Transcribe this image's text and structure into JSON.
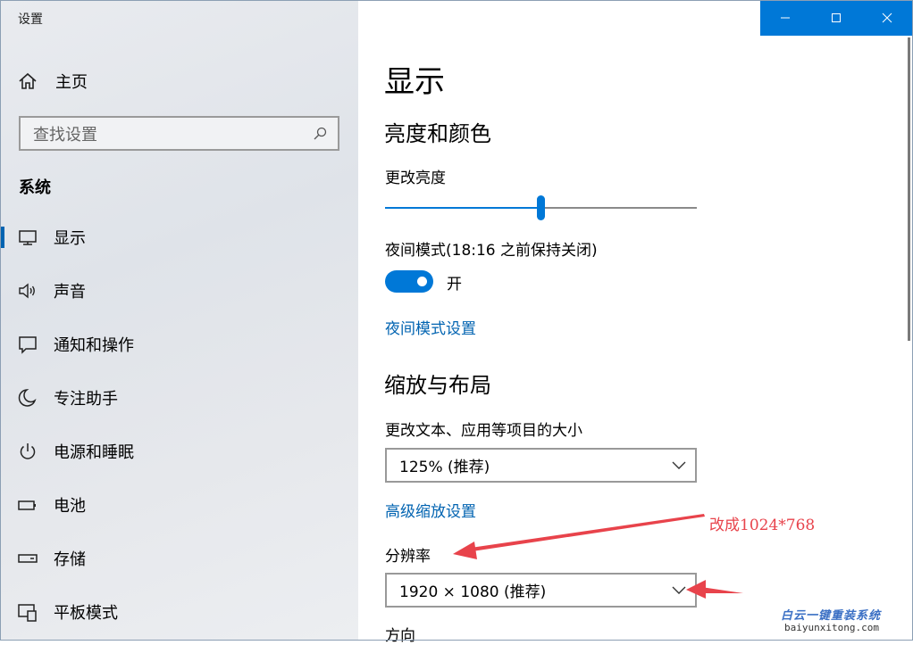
{
  "window": {
    "title": "设置",
    "controls": [
      "minimize",
      "maximize",
      "close"
    ]
  },
  "sidebar": {
    "home_label": "主页",
    "search_placeholder": "查找设置",
    "section_title": "系统",
    "items": [
      {
        "label": "显示",
        "icon": "monitor-icon",
        "active": true
      },
      {
        "label": "声音",
        "icon": "speaker-icon"
      },
      {
        "label": "通知和操作",
        "icon": "notification-icon"
      },
      {
        "label": "专注助手",
        "icon": "moon-icon"
      },
      {
        "label": "电源和睡眠",
        "icon": "power-icon"
      },
      {
        "label": "电池",
        "icon": "battery-icon"
      },
      {
        "label": "存储",
        "icon": "storage-icon"
      },
      {
        "label": "平板模式",
        "icon": "tablet-icon"
      }
    ]
  },
  "main": {
    "title": "显示",
    "brightness_section": "亮度和颜色",
    "brightness_label": "更改亮度",
    "brightness_value": 0.5,
    "night_mode_label": "夜间模式(18:16 之前保持关闭)",
    "night_toggle_state": "开",
    "night_settings_link": "夜间模式设置",
    "scale_section": "缩放与布局",
    "scale_label": "更改文本、应用等项目的大小",
    "scale_value": "125% (推荐)",
    "advanced_scale_link": "高级缩放设置",
    "resolution_label": "分辨率",
    "resolution_value": "1920 × 1080 (推荐)",
    "orientation_label": "方向"
  },
  "annotation": {
    "text": "改成1024*768",
    "color": "#e8434b"
  },
  "watermark": {
    "line1": "白云一键重装系统",
    "line2": "baiyunxitong.com"
  },
  "colors": {
    "accent": "#0078d7",
    "link": "#0063b1"
  }
}
